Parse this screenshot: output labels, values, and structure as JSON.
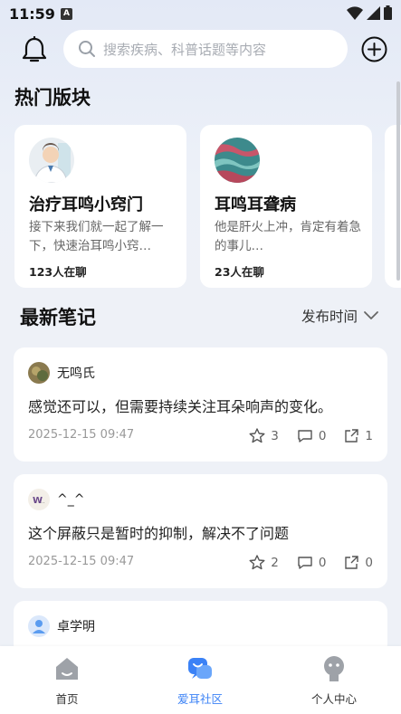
{
  "status_bar": {
    "time": "11:59",
    "badge": "A"
  },
  "header": {
    "search_placeholder": "搜索疾病、科普话题等内容"
  },
  "hot_section": {
    "title": "热门版块",
    "cards": [
      {
        "title": "治疗耳鸣小窍门",
        "description": "接下来我们就一起了解一下，快速治耳鸣小窍…",
        "count": "123人在聊",
        "avatar_icon": "doctor-icon"
      },
      {
        "title": "耳鸣耳聋病",
        "description": "他是肝火上冲，肯定有着急的事儿…",
        "count": "23人在聊",
        "avatar_icon": "pattern-icon"
      }
    ]
  },
  "notes_section": {
    "title": "最新笔记",
    "sort_label": "发布时间",
    "notes": [
      {
        "user": "无鸣氏",
        "text": "感觉还可以，但需要持续关注耳朵响声的变化。",
        "time": "2025-12-15 09:47",
        "likes": "3",
        "comments": "0",
        "shares": "1"
      },
      {
        "user": "^_^",
        "text": "这个屏蔽只是暂时的抑制，解决不了问题",
        "time": "2025-12-15 09:47",
        "likes": "2",
        "comments": "0",
        "shares": "0"
      },
      {
        "user": "卓学明"
      }
    ]
  },
  "tabbar": {
    "tabs": [
      {
        "label": "首页",
        "icon": "home-icon"
      },
      {
        "label": "爱耳社区",
        "icon": "community-icon",
        "active": true
      },
      {
        "label": "个人中心",
        "icon": "profile-icon"
      }
    ]
  },
  "colors": {
    "accent": "#3b82f6",
    "background": "#eef1f7"
  }
}
